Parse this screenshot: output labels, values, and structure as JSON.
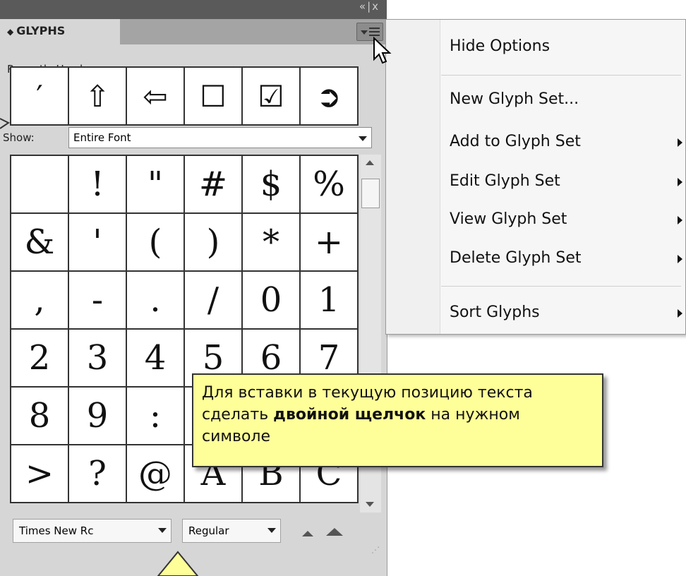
{
  "panel": {
    "tab_label": "GLYPHS",
    "recently_used_label": "Recently Used:",
    "recent_glyphs": [
      "′",
      "⇧",
      "⇦",
      "☐",
      "☑",
      "➲"
    ],
    "show_label": "Show:",
    "show_value": "Entire Font",
    "grid_rows": [
      [
        " ",
        "!",
        "\"",
        "#",
        "$",
        "%"
      ],
      [
        "&",
        "'",
        "(",
        ")",
        "*",
        "+"
      ],
      [
        ",",
        "-",
        ".",
        "/",
        "0",
        "1"
      ],
      [
        "2",
        "3",
        "4",
        "5",
        "6",
        "7"
      ],
      [
        "8",
        "9",
        ":",
        ";",
        "<",
        "="
      ],
      [
        ">",
        "?",
        "@",
        "A",
        "B",
        "C"
      ]
    ],
    "font_value": "Times New Rc",
    "style_value": "Regular"
  },
  "menu": {
    "hide_options": "Hide Options",
    "new_glyph_set": "New Glyph Set...",
    "add_to_glyph_set": "Add to Glyph Set",
    "edit_glyph_set": "Edit Glyph Set",
    "view_glyph_set": "View Glyph Set",
    "delete_glyph_set": "Delete Glyph Set",
    "sort_glyphs": "Sort Glyphs"
  },
  "callout": {
    "line1": "Для вставки в текущую позицию текста",
    "line2_before": "сделать ",
    "line2_bold": "двойной щелчок",
    "line2_after": " на нужном",
    "line3": "символе"
  },
  "icons": {
    "panel_menu": "panel-menu-icon",
    "cursor": "mouse-pointer-icon",
    "zoom_out": "zoom-out-icon",
    "zoom_in": "zoom-in-icon"
  },
  "colors": {
    "callout_bg": "#ffff99",
    "panel_bg": "#d6d6d6",
    "menu_bg": "#f6f6f6"
  }
}
